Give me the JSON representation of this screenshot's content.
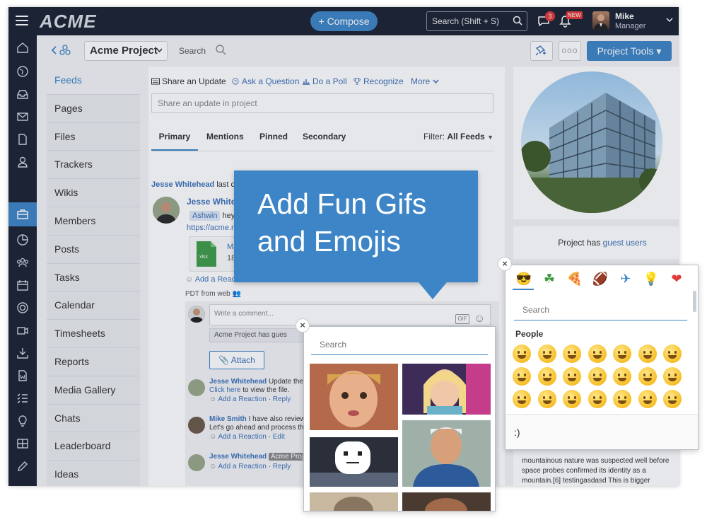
{
  "topbar": {
    "logo": "ACME",
    "compose": "+ Compose",
    "search_placeholder": "Search (Shift + S)",
    "chat_count": "3",
    "new_badge": "NEW",
    "user_name": "Mike",
    "user_role": "Manager"
  },
  "subheader": {
    "project": "Acme Project",
    "search": "Search",
    "more": "ooo",
    "tools": "Project Tools"
  },
  "sidemenu": [
    "Feeds",
    "Pages",
    "Files",
    "Trackers",
    "Wikis",
    "Members",
    "Posts",
    "Tasks",
    "Calendar",
    "Timesheets",
    "Reports",
    "Media Gallery",
    "Chats",
    "Leaderboard",
    "Ideas"
  ],
  "share": {
    "update": "Share an Update",
    "ask": "Ask a Question",
    "poll": "Do a Poll",
    "recognize": "Recognize",
    "more": "More",
    "placeholder": "Share an update in project"
  },
  "tabs": {
    "primary": "Primary",
    "mentions": "Mentions",
    "pinned": "Pinned",
    "secondary": "Secondary",
    "filter_label": "Filter:",
    "filter_value": "All Feeds"
  },
  "post": {
    "header_name": "Jesse Whitehead",
    "header_rest": "last co",
    "author": "Jesse Whiteh",
    "mention": "Ashwin",
    "mention_rest": "hey t",
    "link": "https://acme.m",
    "file_name": "Mar",
    "file_size": "18.4",
    "file_ext": "xlsx",
    "add_reaction": "Add a Reacti",
    "meta": "PDT from web",
    "comment_placeholder": "Write a comment...",
    "gif": "GIF",
    "guest_note": "Acme Project has gues",
    "attach": "Attach"
  },
  "comments": [
    {
      "name": "Jesse Whitehead",
      "text": "Update the",
      "line2": "Click here",
      "line2_rest": "to view the file.",
      "actions": [
        "Add a Reaction",
        "Reply"
      ]
    },
    {
      "name": "Mike Smith",
      "text": "I have also review",
      "line2": "Let's go ahead and process thi",
      "line2_rest": "",
      "actions": [
        "Add a Reaction",
        "Edit"
      ]
    },
    {
      "name": "Jesse Whitehead",
      "text": "Acme Proj",
      "line2": "",
      "line2_rest": "",
      "actions": [
        "Add a Reaction",
        "Reply"
      ]
    }
  ],
  "right": {
    "guest_prefix": "Project has",
    "guest_link": "guest users",
    "desc": "mountainous nature was suspected well before space probes confirmed its identity as a mountain.[6]  testingasdasd  This is bigger"
  },
  "callout": {
    "line1": "Add Fun Gifs",
    "line2": "and Emojis"
  },
  "gif_panel": {
    "search": "Search"
  },
  "emoji_panel": {
    "search": "Search",
    "category": "People",
    "footer": ":)",
    "categories": [
      "😎",
      "☘",
      "🍕",
      "🏈",
      "✈",
      "💡",
      "❤"
    ]
  },
  "colors": {
    "accent": "#3d85c6",
    "topbar": "#1c2333",
    "badge": "#e23a3a"
  }
}
